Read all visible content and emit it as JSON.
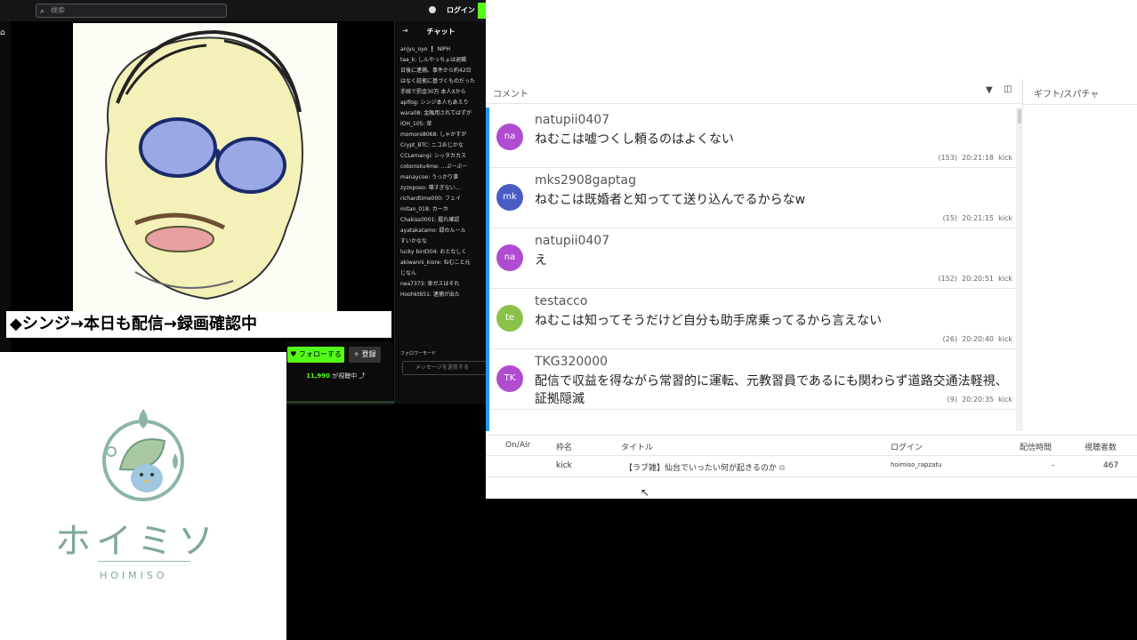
{
  "site": {
    "search_placeholder": "検索",
    "login": "ログイン",
    "banner": "◆シンジ→本日も配信→録画確認中",
    "follow": "フォローする",
    "subscribe": "登録",
    "viewers_count": "11,990",
    "viewers_suffix": "が視聴中"
  },
  "chat": {
    "title": "チャット",
    "input_placeholder": "メッセージを送信する",
    "follower_mode": "フォロワーモード",
    "messages": [
      "anjyu_oyo ❕  NIPH",
      "taa_k: しんやっちょは退職",
      "日後に逮捕。事件から約42日",
      "はなく証拠に基づくものだった",
      "手続で罰金30万 本人Xから",
      "aplfog: シンジ本人もあえり",
      "wara08: 金融用されてはずが",
      "IOH_105: 草",
      "momoro8068: しゃかすが",
      "Crypt_BTC: ニコおじかな",
      "CCLemangi: シッタカカス",
      "cobonsku4me: ...ぷーぷー",
      "manaycoe: うっかり事",
      "zyzoposo: 喋すぎない…",
      "richardtime000: フェイ",
      "mltan_018: カーカ",
      "Chakiss0001: 握れ確認",
      "ayatakatamo: 録のルール",
      "すいかなな",
      "lucky bird304: おとなしく",
      "akiwanni_kiore: ねむこと元",
      "じなん",
      "nea7373: 車ガスはそれ",
      "Hoohkt651: 逮捕が出た"
    ]
  },
  "comments": {
    "label": "コメント",
    "items": [
      {
        "avatar": "na",
        "color": "#b04ccf",
        "name": "natupii0407",
        "text": "ねむこは嘘つくし頼るのはよくない",
        "count": "(153)",
        "time": "20:21:18",
        "platform": "kick"
      },
      {
        "avatar": "mk",
        "color": "#4a5bc4",
        "name": "mks2908gaptag",
        "text": "ねむこは既婚者と知ってて送り込んでるからなw",
        "count": "(15)",
        "time": "20:21:15",
        "platform": "kick"
      },
      {
        "avatar": "na",
        "color": "#b04ccf",
        "name": "natupii0407",
        "text": "え",
        "count": "(152)",
        "time": "20:20:51",
        "platform": "kick"
      },
      {
        "avatar": "te",
        "color": "#8bc34a",
        "name": "testacco",
        "text": "ねむこは知ってそうだけど自分も助手席乗ってるから言えない",
        "count": "(26)",
        "time": "20:20:40",
        "platform": "kick"
      },
      {
        "avatar": "TK",
        "color": "#b04ccf",
        "name": "TKG320000",
        "text": "配信で収益を得ながら常習的に運転、元教習員であるにも関わらず道路交通法軽視、証拠隠滅",
        "count": "(9)",
        "time": "20:20:35",
        "platform": "kick"
      }
    ]
  },
  "gift": {
    "label": "ギフト/スパチャ"
  },
  "table": {
    "headers": [
      "On/Air",
      "枠名",
      "タイトル",
      "ログイン",
      "配信時間",
      "視聴者数"
    ],
    "row": [
      "",
      "kick",
      "【ラブ雑】仙台でいったい何が起きるのか",
      "hoimiso_rapzatu",
      "-",
      "467"
    ]
  },
  "logo": {
    "main": "ホイミソ",
    "sub": "HOIMISO"
  }
}
